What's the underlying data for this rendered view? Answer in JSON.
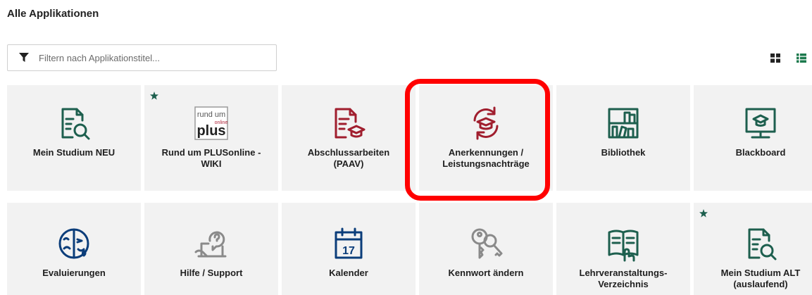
{
  "page": {
    "title": "Alle Applikationen"
  },
  "filter": {
    "placeholder": "Filtern nach Applikationstitel..."
  },
  "icons": {
    "filter": "funnel-icon",
    "view_tiles": "grid-view-icon",
    "view_list": "list-view-icon",
    "favorite": "star-icon"
  },
  "colors": {
    "green": "#1d5f4e",
    "red": "#a01e2e",
    "blue": "#0b3d7a",
    "gray": "#8a8a8a",
    "tile_bg": "#f2f2f2",
    "highlight": "#ff0000"
  },
  "apps": [
    {
      "label": "Mein Studium NEU",
      "icon": "document-search-icon",
      "favorite": false
    },
    {
      "label": "Rund um PLUSonline - WIKI",
      "icon": "rund-um-plus-online-logo",
      "favorite": true,
      "logo_text": {
        "top": "rund um",
        "small": "online",
        "main": "plus"
      }
    },
    {
      "label": "Abschlussarbeiten (PAAV)",
      "icon": "document-graduation-cap-icon",
      "favorite": false
    },
    {
      "label": "Anerkennungen / Leistungsnachträge",
      "icon": "graduation-cap-refresh-icon",
      "favorite": false,
      "highlighted": true
    },
    {
      "label": "Bibliothek",
      "icon": "bookshelf-icon",
      "favorite": false
    },
    {
      "label": "Blackboard",
      "icon": "blackboard-graduation-icon",
      "favorite": false
    },
    {
      "label": "Evaluierungen",
      "icon": "evaluation-faces-icon",
      "favorite": false
    },
    {
      "label": "Hilfe / Support",
      "icon": "help-laptop-icon",
      "favorite": false
    },
    {
      "label": "Kalender",
      "icon": "calendar-icon",
      "favorite": false,
      "calendar_day": "17"
    },
    {
      "label": "Kennwort ändern",
      "icon": "keys-icon",
      "favorite": false
    },
    {
      "label": "Lehrveranstaltungs-Verzeichnis",
      "icon": "open-book-icon",
      "favorite": false
    },
    {
      "label": "Mein Studium ALT (auslaufend)",
      "icon": "document-search-icon",
      "favorite": true
    }
  ]
}
